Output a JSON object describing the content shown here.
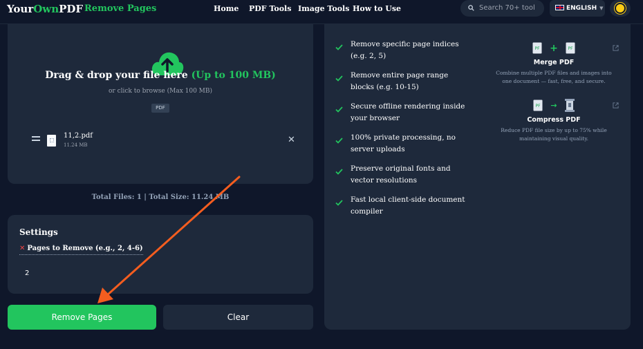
{
  "brand": {
    "part1": "Your",
    "part2": "Own",
    "part3": "PDF"
  },
  "nav": {
    "page_title": "Remove Pages",
    "links": [
      "Home",
      "PDF Tools",
      "Image Tools",
      "How to Use"
    ],
    "search_placeholder": "Search 70+ tool",
    "language": "ENGLISH"
  },
  "upload": {
    "title": "Drag & drop your file here ",
    "title_highlight": "(Up to 100 MB)",
    "subtitle": "or click to browse (Max 100 MB)",
    "badge": "PDF",
    "file": {
      "name": "11,2.pdf",
      "size": "11.24 MB"
    }
  },
  "totals": "Total Files: 1  |  Total Size: 11.24 MB",
  "settings": {
    "title": "Settings",
    "pages_label": "Pages to Remove (e.g., 2, 4-6)",
    "pages_value": "2"
  },
  "buttons": {
    "remove": "Remove Pages",
    "clear": "Clear"
  },
  "features": [
    "Remove specific page indices (e.g. 2, 5)",
    "Remove entire page range blocks (e.g. 10-15)",
    "Secure offline rendering inside your browser",
    "100% private processing, no server uploads",
    "Preserve original fonts and vector resolutions",
    "Fast local client-side document compiler"
  ],
  "tools": [
    {
      "name": "Merge PDF",
      "desc": "Combine multiple PDF files and images into one document — fast, free, and secure."
    },
    {
      "name": "Compress PDF",
      "desc": "Reduce PDF file size by up to 75% while maintaining visual quality."
    }
  ],
  "colors": {
    "accent": "#22c55e",
    "panel": "#1e293b",
    "background": "#0f172a",
    "annotation_arrow": "#f45d1f"
  }
}
